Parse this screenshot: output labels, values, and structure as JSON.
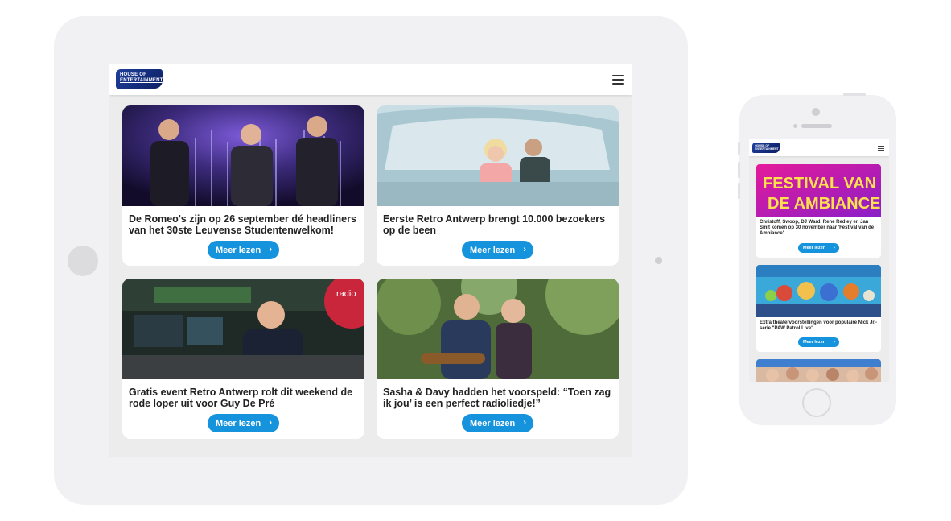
{
  "tablet": {
    "logo": {
      "line1": "HOUSE OF",
      "line2": "ENTERTAINMENT"
    },
    "articles": [
      {
        "title": "De Romeo's zijn op 26 september dé headliners van het 30ste Leuvense Studentenwelkom!",
        "button": "Meer lezen"
      },
      {
        "title": "Eerste Retro Antwerp brengt 10.000 bezoekers op de been",
        "button": "Meer lezen"
      },
      {
        "title": "Gratis event Retro Antwerp rolt dit weekend de rode loper uit voor Guy De Pré",
        "button": "Meer lezen",
        "photo_text": "radio"
      },
      {
        "title": "Sasha & Davy hadden het voorspeld: “Toen zag ik jou’ is een perfect radioliedje!”",
        "button": "Meer lezen"
      }
    ]
  },
  "phone": {
    "logo": {
      "line1": "HOUSE OF",
      "line2": "ENTERTAINMENT"
    },
    "articles": [
      {
        "title": "Christoff, Swoop, DJ Ward, Rene Redley en Jan Smit komen op 30 november naar 'Festival van de Ambiance'",
        "button": "Meer lezen",
        "poster": {
          "line1": "FESTIVAL VAN",
          "line2": "DE AMBIANCE"
        }
      },
      {
        "title": "Extra theatervoorstellingen voor populaire Nick Jr.-serie \"PAW Patrol Live\"",
        "button": "Meer lezen"
      }
    ]
  },
  "colors": {
    "accent": "#1593dc",
    "brand": "#1e3f9c",
    "device": "#f1f0f2"
  },
  "icons": [
    "hamburger-menu-icon",
    "chevron-right-icon"
  ]
}
